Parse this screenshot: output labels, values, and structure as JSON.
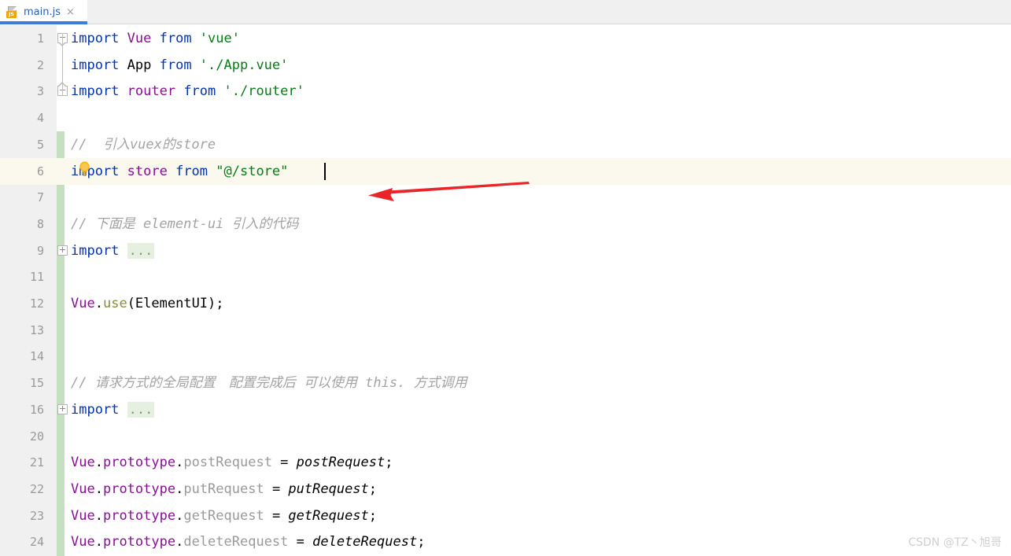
{
  "tab": {
    "filename": "main.js",
    "icon": "js-file-icon",
    "badge_text": "JS",
    "close_glyph": "×",
    "accent_color": "#3b7dd8"
  },
  "editor": {
    "current_line": 6,
    "caret_line": 6,
    "gutter_bg": "#f0f0f0",
    "change_bar_color": "#c6dfc0",
    "current_line_bg": "#fbf8ed",
    "lines": [
      {
        "num": "1",
        "fold": "collapse-start",
        "tokens": [
          {
            "t": "import ",
            "c": "kw"
          },
          {
            "t": "Vue",
            "c": "ident-p"
          },
          {
            "t": " from ",
            "c": "kw"
          },
          {
            "t": "'vue'",
            "c": "str"
          }
        ]
      },
      {
        "num": "2",
        "fold": "none",
        "tokens": [
          {
            "t": "import ",
            "c": "kw"
          },
          {
            "t": "App",
            "c": "plain"
          },
          {
            "t": " from ",
            "c": "kw"
          },
          {
            "t": "'./App.vue'",
            "c": "str"
          }
        ]
      },
      {
        "num": "3",
        "fold": "collapse-end",
        "tokens": [
          {
            "t": "import ",
            "c": "kw"
          },
          {
            "t": "router",
            "c": "ident-p"
          },
          {
            "t": " from ",
            "c": "kw"
          },
          {
            "t": "'./router'",
            "c": "str"
          }
        ]
      },
      {
        "num": "4",
        "fold": "none",
        "tokens": []
      },
      {
        "num": "5",
        "fold": "none",
        "hint_icon": "lightbulb-icon",
        "tokens": [
          {
            "t": "//  引入vuex的store",
            "c": "cmt"
          }
        ]
      },
      {
        "num": "6",
        "fold": "none",
        "current": true,
        "tokens": [
          {
            "t": "import ",
            "c": "kw"
          },
          {
            "t": "store",
            "c": "ident-p"
          },
          {
            "t": " from ",
            "c": "kw"
          },
          {
            "t": "\"@/store\"",
            "c": "str"
          }
        ]
      },
      {
        "num": "7",
        "fold": "none",
        "tokens": []
      },
      {
        "num": "8",
        "fold": "none",
        "tokens": [
          {
            "t": "// 下面是 element-ui 引入的代码",
            "c": "cmt"
          }
        ]
      },
      {
        "num": "9",
        "fold": "expand",
        "tokens": [
          {
            "t": "import ",
            "c": "kw"
          },
          {
            "t": "...",
            "c": "fold-ellipsis"
          }
        ]
      },
      {
        "num": "11",
        "fold": "none",
        "tokens": []
      },
      {
        "num": "12",
        "fold": "none",
        "tokens": [
          {
            "t": "Vue",
            "c": "ident-p"
          },
          {
            "t": ".",
            "c": "plain"
          },
          {
            "t": "use",
            "c": "fn"
          },
          {
            "t": "(ElementUI);",
            "c": "plain"
          }
        ]
      },
      {
        "num": "13",
        "fold": "none",
        "tokens": []
      },
      {
        "num": "14",
        "fold": "none",
        "tokens": []
      },
      {
        "num": "15",
        "fold": "none",
        "tokens": [
          {
            "t": "// 请求方式的全局配置　配置完成后 可以使用 this. 方式调用",
            "c": "cmt"
          }
        ]
      },
      {
        "num": "16",
        "fold": "expand",
        "tokens": [
          {
            "t": "import ",
            "c": "kw"
          },
          {
            "t": "...",
            "c": "fold-ellipsis"
          }
        ]
      },
      {
        "num": "20",
        "fold": "none",
        "tokens": []
      },
      {
        "num": "21",
        "fold": "none",
        "tokens": [
          {
            "t": "Vue",
            "c": "ident-p"
          },
          {
            "t": ".",
            "c": "plain"
          },
          {
            "t": "prototype",
            "c": "ident-p"
          },
          {
            "t": ".",
            "c": "plain"
          },
          {
            "t": "postRequest",
            "c": "prop"
          },
          {
            "t": " = ",
            "c": "plain"
          },
          {
            "t": "postRequest",
            "c": "plain italic"
          },
          {
            "t": ";",
            "c": "plain"
          }
        ]
      },
      {
        "num": "22",
        "fold": "none",
        "tokens": [
          {
            "t": "Vue",
            "c": "ident-p"
          },
          {
            "t": ".",
            "c": "plain"
          },
          {
            "t": "prototype",
            "c": "ident-p"
          },
          {
            "t": ".",
            "c": "plain"
          },
          {
            "t": "putRequest",
            "c": "prop"
          },
          {
            "t": " = ",
            "c": "plain"
          },
          {
            "t": "putRequest",
            "c": "plain italic"
          },
          {
            "t": ";",
            "c": "plain"
          }
        ]
      },
      {
        "num": "23",
        "fold": "none",
        "tokens": [
          {
            "t": "Vue",
            "c": "ident-p"
          },
          {
            "t": ".",
            "c": "plain"
          },
          {
            "t": "prototype",
            "c": "ident-p"
          },
          {
            "t": ".",
            "c": "plain"
          },
          {
            "t": "getRequest",
            "c": "prop"
          },
          {
            "t": " = ",
            "c": "plain"
          },
          {
            "t": "getRequest",
            "c": "plain italic"
          },
          {
            "t": ";",
            "c": "plain"
          }
        ]
      },
      {
        "num": "24",
        "fold": "none",
        "tokens": [
          {
            "t": "Vue",
            "c": "ident-p"
          },
          {
            "t": ".",
            "c": "plain"
          },
          {
            "t": "prototype",
            "c": "ident-p"
          },
          {
            "t": ".",
            "c": "plain"
          },
          {
            "t": "deleteRequest",
            "c": "prop"
          },
          {
            "t": " = ",
            "c": "plain"
          },
          {
            "t": "deleteRequest",
            "c": "plain italic"
          },
          {
            "t": ";",
            "c": "plain"
          }
        ]
      }
    ]
  },
  "annotation": {
    "type": "red-arrow",
    "direction": "left",
    "color": "#e8262a",
    "points_at_line": 6
  },
  "watermark": {
    "text": "CSDN @TZ丶旭哥",
    "color": "#cfcfcf"
  }
}
